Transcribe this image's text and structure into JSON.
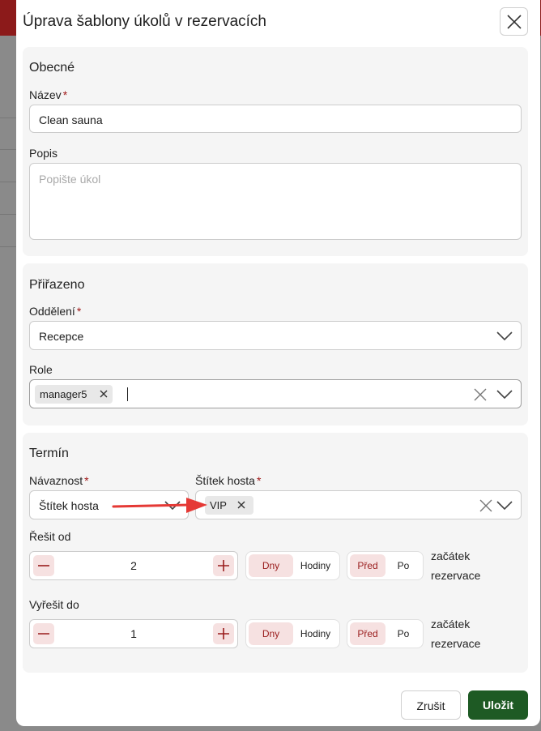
{
  "modal": {
    "title": "Úprava šablony úkolů v rezervacích"
  },
  "general": {
    "title": "Obecné",
    "name_label": "Název",
    "name_value": "Clean sauna",
    "description_label": "Popis",
    "description_placeholder": "Popište úkol"
  },
  "assigned": {
    "title": "Přiřazeno",
    "department_label": "Oddělení",
    "department_value": "Recepce",
    "role_label": "Role",
    "role_chips": [
      "manager5"
    ]
  },
  "deadline": {
    "title": "Termín",
    "dependency_label": "Návaznost",
    "dependency_value": "Štítek hosta",
    "guest_tag_label": "Štítek hosta",
    "guest_tag_chips": [
      "VIP"
    ],
    "solve_from": {
      "label": "Řešit od",
      "value": "2",
      "unit_options": [
        "Dny",
        "Hodiny"
      ],
      "unit_selected": "Dny",
      "relation_options": [
        "Před",
        "Po"
      ],
      "relation_selected": "Před",
      "anchor_line1": "začátek",
      "anchor_line2": "rezervace"
    },
    "solve_until": {
      "label": "Vyřešit do",
      "value": "1",
      "unit_options": [
        "Dny",
        "Hodiny"
      ],
      "unit_selected": "Dny",
      "relation_options": [
        "Před",
        "Po"
      ],
      "relation_selected": "Před",
      "anchor_line1": "začátek",
      "anchor_line2": "rezervace"
    }
  },
  "required_mark": "*",
  "footer": {
    "cancel_label": "Zrušit",
    "save_label": "Uložit"
  },
  "icons": {
    "close": "close-icon",
    "chevron": "chevron-down-icon",
    "remove_chip": "remove-icon",
    "clear": "clear-icon",
    "minus": "minus-icon",
    "plus": "plus-icon",
    "annotation": "arrow-icon"
  },
  "colors": {
    "brand": "#8c1a1a",
    "primary_button": "#1e5a24",
    "accent_soft": "#f6e1e1",
    "accent_text": "#9a1d1d",
    "annotation_arrow": "#e53935"
  }
}
